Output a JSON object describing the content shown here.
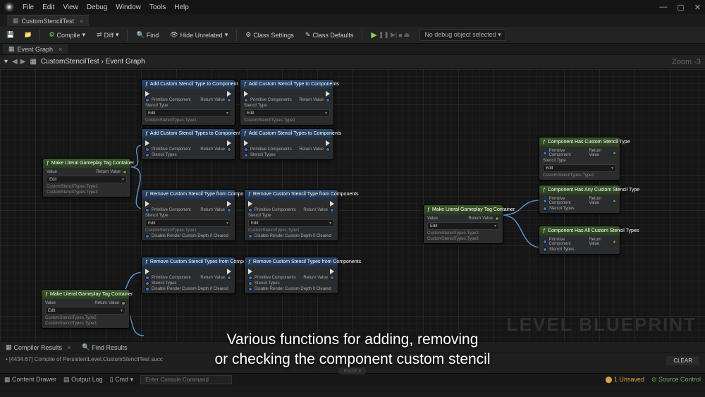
{
  "menu": {
    "items": [
      "File",
      "Edit",
      "View",
      "Debug",
      "Window",
      "Tools",
      "Help"
    ]
  },
  "window": {
    "min": "—",
    "max": "▢",
    "close": "✕"
  },
  "asset_tab": {
    "label": "CustomStencilTest",
    "icon": "cube"
  },
  "toolbar": {
    "compile": "Compile",
    "diff": "Diff",
    "find": "Find",
    "hide": "Hide Unrelated",
    "class_settings": "Class Settings",
    "class_defaults": "Class Defaults",
    "debug_filter": "No debug object selected"
  },
  "subtab": {
    "label": "Event Graph"
  },
  "breadcrumb": {
    "asset": "CustomStencilTest",
    "graph": "Event Graph",
    "zoom": "Zoom -3"
  },
  "watermark": "LEVEL BLUEPRINT",
  "caption_line1": "Various functions for adding, removing",
  "caption_line2": "or checking the component custom stencil",
  "compiler": {
    "tab1": "Compiler Results",
    "tab2": "Find Results",
    "msg": "[4434.67] Compile of PersistentLevel.CustomStencilTest succ",
    "clear": "CLEAR",
    "page": "PAGE"
  },
  "statusbar": {
    "content_drawer": "Content Drawer",
    "output_log": "Output Log",
    "cmd_label": "Cmd",
    "cmd_placeholder": "Enter Console Command",
    "unsaved": "1 Unsaved",
    "source_ctrl": "Source Control"
  },
  "nodes": {
    "n1": {
      "title": "Add Custom Stencil Type to Component",
      "pin_comp": "Primitive Component",
      "pin_type": "Stencil Type",
      "opt": "CustomStencilTypes.Type1",
      "pin_out": "Return Value",
      "pin_edit": "Edit"
    },
    "n2": {
      "title": "Add Custom Stencil Type to Components",
      "pin_comp": "Primitive Components",
      "pin_type": "Stencil Type",
      "opt": "CustomStencilTypes.Type1",
      "pin_out": "Return Value",
      "pin_edit": "Edit"
    },
    "n3": {
      "title": "Add Custom Stencil Types to Component",
      "pin_comp": "Primitive Component",
      "pin_types": "Stencil Types",
      "pin_out": "Return Value"
    },
    "n4": {
      "title": "Add Custom Stencil Types to Components",
      "pin_comp": "Primitive Components",
      "pin_types": "Stencil Types",
      "pin_out": "Return Value"
    },
    "n5": {
      "title": "Remove Custom Stencil Type from Component",
      "pin_comp": "Primitive Component",
      "pin_type": "Stencil Type",
      "opt": "CustomStencilTypes.Type1",
      "pin_out": "Return Value",
      "pin_edit": "Edit",
      "pin_disable": "Disable Render Custom Depth if Cleared"
    },
    "n6": {
      "title": "Remove Custom Stencil Type from Components",
      "pin_comp": "Primitive Components",
      "pin_type": "Stencil Type",
      "opt": "CustomStencilTypes.Type1",
      "pin_out": "Return Value",
      "pin_edit": "Edit",
      "pin_disable": "Disable Render Custom Depth if Cleared"
    },
    "n7": {
      "title": "Remove Custom Stencil Types from Component",
      "pin_comp": "Primitive Component",
      "pin_types": "Stencil Types",
      "pin_out": "Return Value",
      "pin_disable": "Disable Render Custom Depth if Cleared"
    },
    "n8": {
      "title": "Remove Custom Stencil Types from Components",
      "pin_comp": "Primitive Components",
      "pin_types": "Stencil Types",
      "pin_out": "Return Value",
      "pin_disable": "Disable Render Custom Depth if Cleared"
    },
    "tag1": {
      "title": "Make Literal Gameplay Tag Container",
      "val": "Value",
      "out": "Return Value",
      "edit": "Edit",
      "l1": "CustomStencilTypes.Type2",
      "l2": "CustomStencilTypes.Type3"
    },
    "tag2": {
      "title": "Make Literal Gameplay Tag Container",
      "val": "Value",
      "out": "Return Value",
      "edit": "Edit",
      "l1": "CustomStencilTypes.Type2",
      "l2": "CustomStencilTypes.Type3"
    },
    "tag3": {
      "title": "Make Literal Gameplay Tag Container",
      "val": "Value",
      "out": "Return Value",
      "edit": "Edit",
      "l1": "CustomStencilTypes.Type2",
      "l2": "CustomStencilTypes.Type3"
    },
    "c1": {
      "title": "Component Has Custom Stencil Type",
      "pin_comp": "Primitive Component",
      "pin_type": "Stencil Type",
      "opt": "CustomStencilTypes.Type1",
      "out": "Return Value",
      "edit": "Edit"
    },
    "c2": {
      "title": "Component Has Any Custom Stencil Type",
      "pin_comp": "Primitive Component",
      "pin_types": "Stencil Types",
      "out": "Return Value"
    },
    "c3": {
      "title": "Component Has All Custom Stencil Types",
      "pin_comp": "Primitive Component",
      "pin_types": "Stencil Types",
      "out": "Return Value"
    }
  }
}
